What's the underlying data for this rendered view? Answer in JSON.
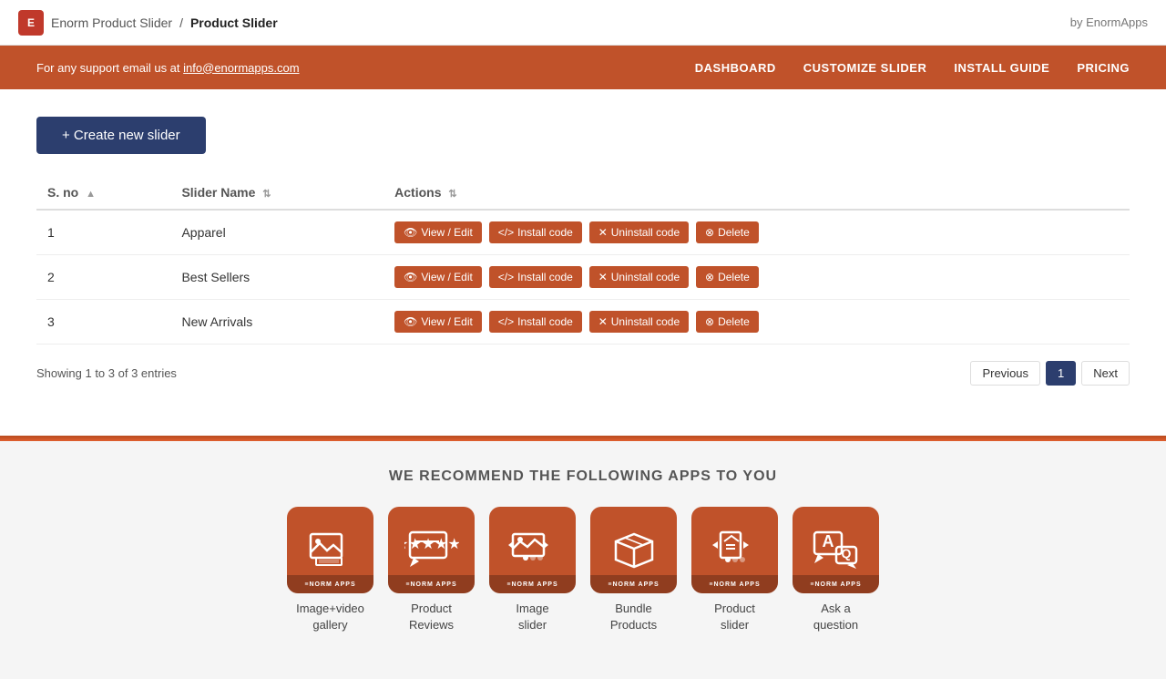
{
  "topbar": {
    "app_name": "Enorm Product Slider",
    "separator": "/",
    "page_name": "Product Slider",
    "by_label": "by EnormApps"
  },
  "navbar": {
    "support_text": "For any support email us at",
    "support_email": "info@enormapps.com",
    "links": [
      {
        "label": "DASHBOARD",
        "key": "dashboard"
      },
      {
        "label": "CUSTOMIZE SLIDER",
        "key": "customize"
      },
      {
        "label": "INSTALL GUIDE",
        "key": "install"
      },
      {
        "label": "PRICING",
        "key": "pricing"
      }
    ]
  },
  "create_button": "+ Create new slider",
  "table": {
    "headers": [
      {
        "label": "S. no",
        "key": "sno"
      },
      {
        "label": "Slider Name",
        "key": "name"
      },
      {
        "label": "Actions",
        "key": "actions"
      }
    ],
    "rows": [
      {
        "sno": "1",
        "name": "Apparel"
      },
      {
        "sno": "2",
        "name": "Best Sellers"
      },
      {
        "sno": "3",
        "name": "New Arrivals"
      }
    ],
    "action_buttons": {
      "view_edit": "View / Edit",
      "install_code": "Install code",
      "uninstall_code": "Uninstall code",
      "delete": "Delete"
    }
  },
  "pagination": {
    "showing_text": "Showing 1 to 3 of 3 entries",
    "previous": "Previous",
    "current_page": "1",
    "next": "Next"
  },
  "recommendations": {
    "title": "WE RECOMMEND THE FOLLOWING APPS TO YOU",
    "apps": [
      {
        "label": "Image+video\ngallery",
        "icon": "image-video-gallery-icon"
      },
      {
        "label": "Product\nReviews",
        "icon": "product-reviews-icon"
      },
      {
        "label": "Image\nslider",
        "icon": "image-slider-icon"
      },
      {
        "label": "Bundle\nProducts",
        "icon": "bundle-products-icon"
      },
      {
        "label": "Product\nslider",
        "icon": "product-slider-icon"
      },
      {
        "label": "Ask a\nquestion",
        "icon": "ask-question-icon"
      }
    ]
  }
}
